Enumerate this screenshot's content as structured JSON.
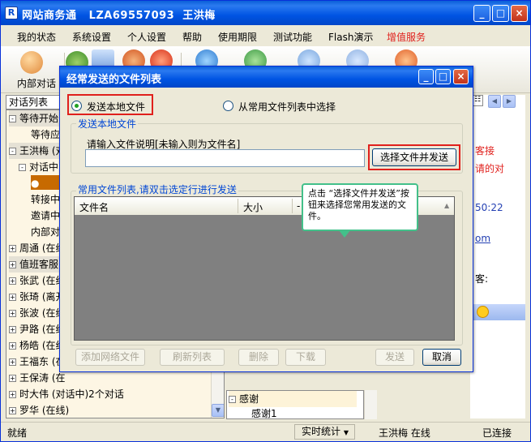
{
  "app": {
    "title": "网站商务通   LZA69557093  王洪梅",
    "icon_letter": "R",
    "controls": [
      "_",
      "□",
      "×"
    ]
  },
  "menu": [
    "我的状态",
    "系统设置",
    "个人设置",
    "帮助",
    "使用期限",
    "测试功能",
    "Flash演示",
    "增值服务"
  ],
  "colors": {
    "menu_highlight": "#E0201C",
    "titlebar": "#0054E3",
    "panel_bg": "#FDF6E4",
    "tip_border": "#43C08A"
  },
  "toolbar": {
    "internal_chat_label": "内部对话"
  },
  "left_panel": {
    "header": "对话列表",
    "rows": [
      "等待开始",
      "等待应",
      "王洪梅 (对",
      "对话中",
      "",
      "转接中",
      "邀请中",
      "内部对",
      "周通 (在线",
      "值班客服",
      "张武 (在线",
      "张琦 (离开",
      "张波 (在线",
      "尹路 (在线",
      "杨皓 (在线",
      "王福东 (在",
      "王保涛 (在",
      "时大伟 (对话中)2个对话",
      "罗华 (在线)"
    ]
  },
  "right_area": {
    "snippets": [
      "客接",
      "请的对",
      "50:22",
      "om",
      "客:"
    ],
    "tree_group": "感谢",
    "tree_item": "感谢1"
  },
  "status": {
    "ready": "就绪",
    "realtime": "实时统计",
    "user": "王洪梅 在线",
    "connected": "已连接"
  },
  "dialog": {
    "title": "经常发送的文件列表",
    "radio_local": "发送本地文件",
    "radio_list": "从常用文件列表中选择",
    "group_local": "发送本地文件",
    "prompt": "请输入文件说明[未输入则为文件名]",
    "input_value": "",
    "choose_button": "选择文件并发送",
    "group_list": "常用文件列表,请双击选定行进行发送",
    "columns": [
      "文件名",
      "大小",
      "-"
    ],
    "buttons": {
      "add_net": "添加网络文件",
      "refresh": "刷新列表",
      "delete": "删除",
      "download": "下载",
      "send": "发送",
      "cancel": "取消"
    }
  },
  "tooltip": {
    "text": "点击 “选择文件并发送”按钮来选择您常用发送的文件。"
  }
}
